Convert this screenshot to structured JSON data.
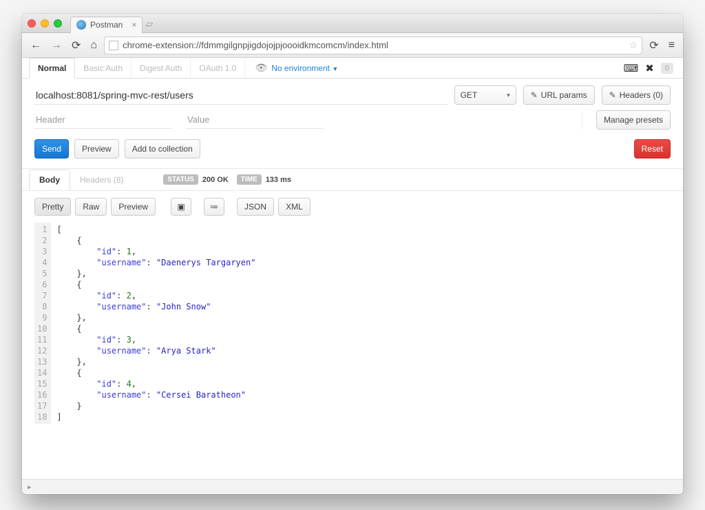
{
  "window": {
    "tab_title": "Postman"
  },
  "address_bar": {
    "url": "chrome-extension://fdmmgilgnpjigdojojpjoooidkmcomcm/index.html"
  },
  "auth_tabs": [
    "Normal",
    "Basic Auth",
    "Digest Auth",
    "OAuth 1.0"
  ],
  "auth_active_index": 0,
  "environment": {
    "label": "No environment"
  },
  "toolbar_badge": "0",
  "request": {
    "url": "localhost:8081/spring-mvc-rest/users",
    "method": "GET",
    "url_params_btn": "URL params",
    "headers_btn": "Headers (0)"
  },
  "headers_form": {
    "header_placeholder": "Header",
    "value_placeholder": "Value",
    "manage_presets": "Manage presets"
  },
  "actions": {
    "send": "Send",
    "preview": "Preview",
    "add": "Add to collection",
    "reset": "Reset"
  },
  "response": {
    "tabs": [
      "Body",
      "Headers (8)"
    ],
    "active_tab": 0,
    "status_label": "STATUS",
    "status_value": "200 OK",
    "time_label": "TIME",
    "time_value": "133 ms"
  },
  "body_toolbar": {
    "pretty": "Pretty",
    "raw": "Raw",
    "preview": "Preview",
    "json": "JSON",
    "xml": "XML"
  },
  "response_body": [
    {
      "id": 1,
      "username": "Daenerys Targaryen"
    },
    {
      "id": 2,
      "username": "John Snow"
    },
    {
      "id": 3,
      "username": "Arya Stark"
    },
    {
      "id": 4,
      "username": "Cersei Baratheon"
    }
  ]
}
